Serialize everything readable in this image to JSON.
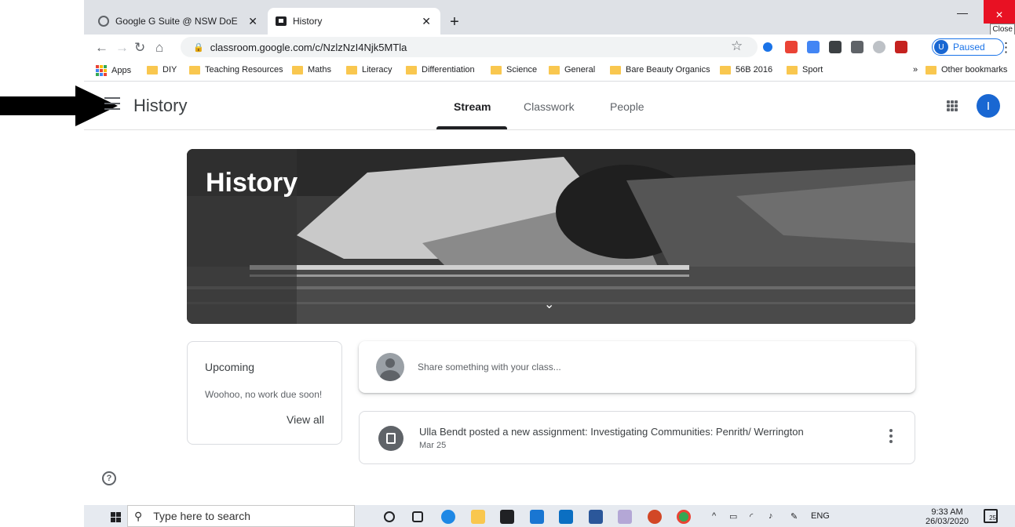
{
  "browser": {
    "tabs": [
      {
        "label": "Google G Suite @ NSW DoE",
        "close": "✕"
      },
      {
        "label": "History",
        "close": "✕"
      }
    ],
    "new_tab": "+",
    "window": {
      "minimize": "—",
      "restore": "❐",
      "close": "✕",
      "close_tooltip": "Close"
    },
    "url": "classroom.google.com/c/NzlzNzI4Njk5MTla",
    "profile": {
      "initial": "U",
      "status": "Paused"
    },
    "menu": "⋮",
    "bookmarks": [
      "Apps",
      "DIY",
      "Teaching Resources",
      "Maths",
      "Literacy",
      "Differentiation",
      "Science",
      "General",
      "Bare Beauty Organics",
      "56B 2016",
      "Sport"
    ],
    "bookmarks_more": "»",
    "other_bookmarks": "Other bookmarks"
  },
  "classroom": {
    "class_name": "History",
    "tabs": [
      "Stream",
      "Classwork",
      "People"
    ],
    "active_tab": "Stream",
    "account_initial": "I",
    "banner_title": "History",
    "upcoming": {
      "title": "Upcoming",
      "message": "Woohoo, no work due soon!",
      "view_all": "View all"
    },
    "share_placeholder": "Share something with your class...",
    "post": {
      "title": "Ulla Bendt posted a new assignment: Investigating Communities: Penrith/ Werrington",
      "date": "Mar 25"
    },
    "help": "?"
  },
  "taskbar": {
    "search_placeholder": "Type here to search",
    "lang": "ENG",
    "time": "9:33 AM",
    "date": "26/03/2020",
    "notifications": "25"
  },
  "colors": {
    "accent": "#1967d2",
    "close_red": "#e81123",
    "folder": "#f9c74f"
  }
}
